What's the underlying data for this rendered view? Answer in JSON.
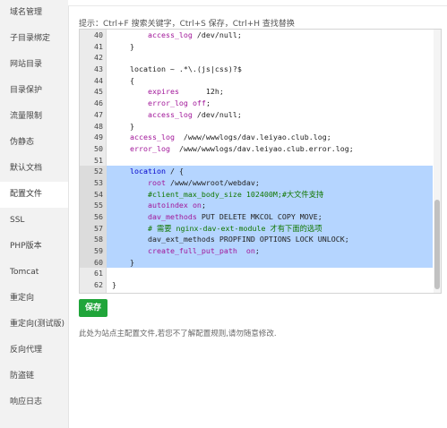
{
  "sidebar": {
    "items": [
      {
        "label": "域名管理",
        "active": false
      },
      {
        "label": "子目录绑定",
        "active": false
      },
      {
        "label": "网站目录",
        "active": false
      },
      {
        "label": "目录保护",
        "active": false
      },
      {
        "label": "流量限制",
        "active": false
      },
      {
        "label": "伪静态",
        "active": false
      },
      {
        "label": "默认文档",
        "active": false
      },
      {
        "label": "配置文件",
        "active": true
      },
      {
        "label": "SSL",
        "active": false
      },
      {
        "label": "PHP版本",
        "active": false
      },
      {
        "label": "Tomcat",
        "active": false
      },
      {
        "label": "重定向",
        "active": false
      },
      {
        "label": "重定向(测试版)",
        "active": false
      },
      {
        "label": "反向代理",
        "active": false
      },
      {
        "label": "防盗链",
        "active": false
      },
      {
        "label": "响应日志",
        "active": false
      }
    ]
  },
  "tip": "提示：Ctrl+F 搜索关键字，Ctrl+S 保存，Ctrl+H 查找替换",
  "editor": {
    "lines": [
      {
        "n": "40",
        "sel": false,
        "tokens": [
          [
            "        ",
            "plain"
          ],
          [
            "access_log",
            "dir"
          ],
          [
            " /dev/null;",
            "plain"
          ]
        ]
      },
      {
        "n": "41",
        "sel": false,
        "tokens": [
          [
            "    }",
            "plain"
          ]
        ]
      },
      {
        "n": "42",
        "sel": false,
        "tokens": []
      },
      {
        "n": "43",
        "sel": false,
        "tokens": [
          [
            "    location ~ .*\\.(js|css)?$",
            "plain"
          ]
        ]
      },
      {
        "n": "44",
        "sel": false,
        "tokens": [
          [
            "    {",
            "plain"
          ]
        ]
      },
      {
        "n": "45",
        "sel": false,
        "tokens": [
          [
            "        ",
            "plain"
          ],
          [
            "expires",
            "dir"
          ],
          [
            "      12h;",
            "plain"
          ]
        ]
      },
      {
        "n": "46",
        "sel": false,
        "tokens": [
          [
            "        ",
            "plain"
          ],
          [
            "error_log",
            "dir"
          ],
          [
            " ",
            "plain"
          ],
          [
            "off",
            "dir"
          ],
          [
            ";",
            "plain"
          ]
        ]
      },
      {
        "n": "47",
        "sel": false,
        "tokens": [
          [
            "        ",
            "plain"
          ],
          [
            "access_log",
            "dir"
          ],
          [
            " /dev/null;",
            "plain"
          ]
        ]
      },
      {
        "n": "48",
        "sel": false,
        "tokens": [
          [
            "    }",
            "plain"
          ]
        ]
      },
      {
        "n": "49",
        "sel": false,
        "tokens": [
          [
            "    ",
            "plain"
          ],
          [
            "access_log",
            "dir"
          ],
          [
            "  /www/wwwlogs/dav.leiyao.club.log;",
            "plain"
          ]
        ]
      },
      {
        "n": "50",
        "sel": false,
        "tokens": [
          [
            "    ",
            "plain"
          ],
          [
            "error_log",
            "dir"
          ],
          [
            "  /www/wwwlogs/dav.leiyao.club.error.log;",
            "plain"
          ]
        ]
      },
      {
        "n": "51",
        "sel": false,
        "tokens": []
      },
      {
        "n": "52",
        "sel": true,
        "tokens": [
          [
            "    ",
            "plain"
          ],
          [
            "location",
            "kw"
          ],
          [
            " / {",
            "plain"
          ]
        ]
      },
      {
        "n": "53",
        "sel": true,
        "tokens": [
          [
            "        ",
            "plain"
          ],
          [
            "root",
            "dir"
          ],
          [
            " /www/wwwroot/webdav;",
            "plain"
          ]
        ]
      },
      {
        "n": "54",
        "sel": true,
        "tokens": [
          [
            "        ",
            "plain"
          ],
          [
            "#client_max_body_size 102400M;#大文件支持",
            "com"
          ]
        ]
      },
      {
        "n": "55",
        "sel": true,
        "tokens": [
          [
            "        ",
            "plain"
          ],
          [
            "autoindex",
            "dir"
          ],
          [
            " ",
            "plain"
          ],
          [
            "on",
            "dir"
          ],
          [
            ";",
            "plain"
          ]
        ]
      },
      {
        "n": "56",
        "sel": true,
        "tokens": [
          [
            "        ",
            "plain"
          ],
          [
            "dav_methods",
            "dir"
          ],
          [
            " PUT DELETE MKCOL COPY MOVE;",
            "plain"
          ]
        ]
      },
      {
        "n": "57",
        "sel": true,
        "tokens": [
          [
            "        ",
            "plain"
          ],
          [
            "# 需要 nginx-dav-ext-module 才有下面的选项",
            "com"
          ]
        ]
      },
      {
        "n": "58",
        "sel": true,
        "tokens": [
          [
            "        ",
            "plain"
          ],
          [
            "dav_ext_methods PROPFIND OPTIONS LOCK UNLOCK;",
            "plain"
          ]
        ]
      },
      {
        "n": "59",
        "sel": true,
        "tokens": [
          [
            "        ",
            "plain"
          ],
          [
            "create_full_put_path",
            "dir"
          ],
          [
            "  ",
            "plain"
          ],
          [
            "on",
            "dir"
          ],
          [
            ";",
            "plain"
          ]
        ]
      },
      {
        "n": "60",
        "sel": true,
        "tokens": [
          [
            "    }",
            "plain"
          ]
        ]
      },
      {
        "n": "61",
        "sel": false,
        "tokens": []
      },
      {
        "n": "62",
        "sel": false,
        "tokens": [
          [
            "}",
            "plain"
          ]
        ]
      }
    ]
  },
  "save_label": "保存",
  "note": "此处为站点主配置文件,若您不了解配置规则,请勿随意修改."
}
